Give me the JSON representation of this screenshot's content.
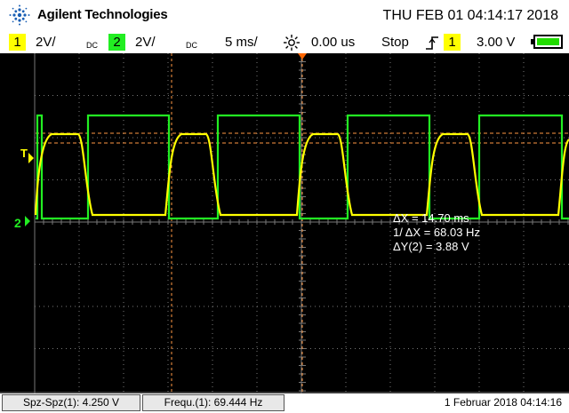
{
  "header": {
    "brand": "Agilent Technologies",
    "datetime": "THU FEB 01 04:14:17 2018"
  },
  "status": {
    "ch1": {
      "num": "1",
      "scale": "2V/",
      "coupling": "DC",
      "color": "#ffff00"
    },
    "ch2": {
      "num": "2",
      "scale": "2V/",
      "coupling": "DC",
      "color": "#22ee22"
    },
    "timebase": "5 ms/",
    "delay": "0.00 us",
    "run_state": "Stop",
    "trigger_channel": "1",
    "trigger_level": "3.00 V"
  },
  "markers": {
    "trigger": "T",
    "ch2_ground": "2"
  },
  "measurements": {
    "dx": "ΔX = 14.70 ms",
    "inv_dx": "1/ ΔX = 68.03 Hz",
    "dy": "ΔY(2) = 3.88 V"
  },
  "bottom": {
    "meas1": "Spz-Spz(1): 4.250 V",
    "meas2": "Frequ.(1): 69.444 Hz",
    "date": "1 Februar 2018  04:14:16"
  },
  "colors": {
    "ch1": "#ffff00",
    "ch2": "#22ee22",
    "cursor": "#ff9944",
    "grid": "#777777",
    "trigger_marker": "#ff6600"
  }
}
